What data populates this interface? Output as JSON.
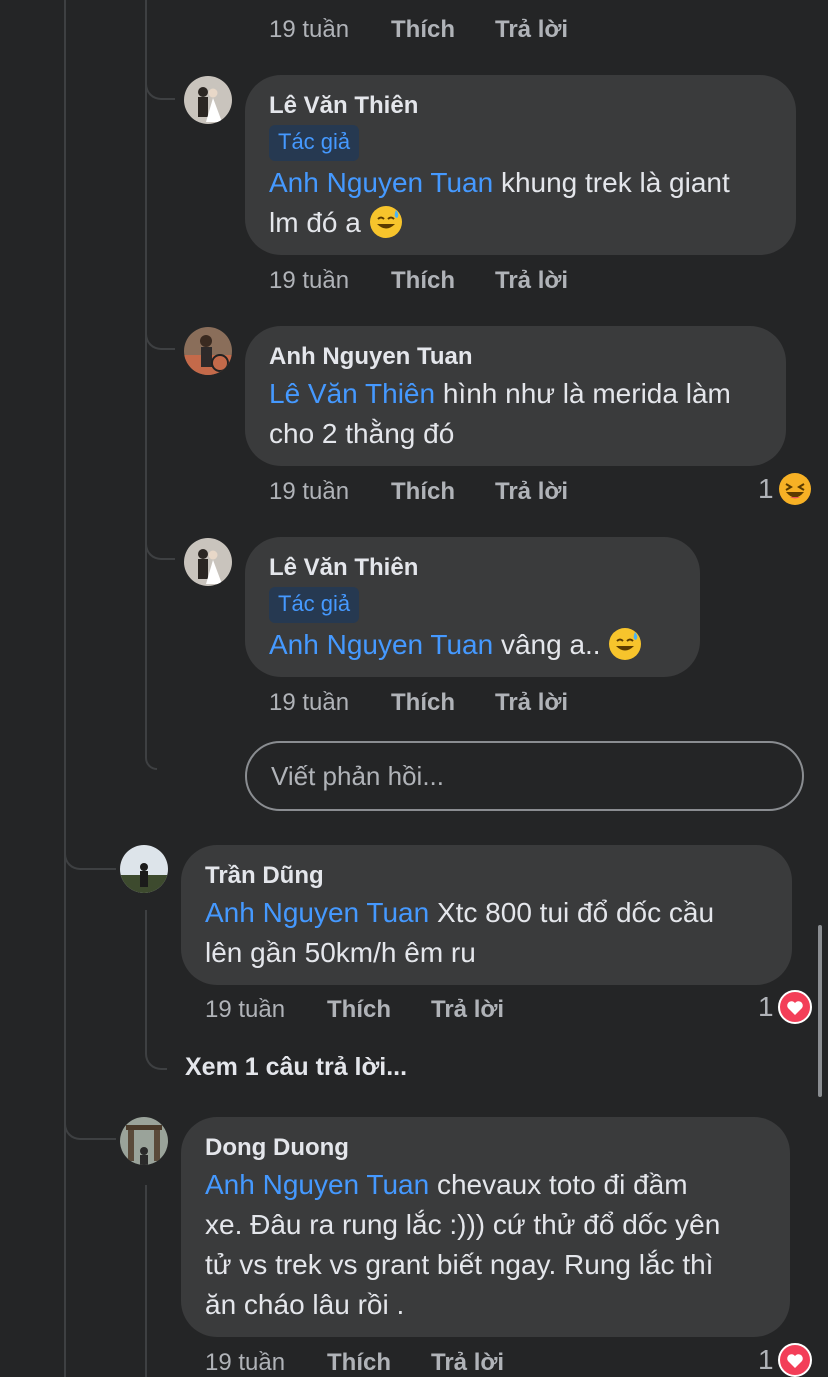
{
  "labels": {
    "like": "Thích",
    "reply": "Trả lời",
    "author_badge": "Tác giả"
  },
  "top_meta": {
    "time": "19 tuần"
  },
  "replies": [
    {
      "author": "Lê Văn Thiên",
      "is_author": true,
      "mention": "Anh Nguyen Tuan",
      "text_lines": [
        " khung trek là giant",
        "lm đó a "
      ],
      "emoji": "sweat-smile-emoji",
      "time": "19 tuần"
    },
    {
      "author": "Anh Nguyen Tuan",
      "is_author": false,
      "mention": "Lê Văn Thiên",
      "text_lines": [
        " hình như là merida làm",
        "cho 2 thằng đó"
      ],
      "time": "19 tuần",
      "reaction_count": "1",
      "reaction": "laugh-emoji"
    },
    {
      "author": "Lê Văn Thiên",
      "is_author": true,
      "mention": "Anh Nguyen Tuan",
      "text_lines": [
        " vâng a.. "
      ],
      "emoji": "sweat-smile-emoji",
      "time": "19 tuần"
    }
  ],
  "reply_input": {
    "placeholder": "Viết phản hồi..."
  },
  "comments": [
    {
      "author": "Trần Dũng",
      "mention": "Anh Nguyen Tuan",
      "text_lines": [
        " Xtc 800 tui đổ dốc cầu",
        "lên gần 50km/h êm ru"
      ],
      "time": "19 tuần",
      "reaction_count": "1",
      "reaction": "love-icon",
      "view_replies": "Xem 1 câu trả lời..."
    },
    {
      "author": "Dong Duong",
      "mention": "Anh Nguyen Tuan",
      "text_lines": [
        " chevaux toto đi đầm",
        "xe. Đâu ra rung lắc :))) cứ thử đổ dốc yên",
        "tử vs trek vs grant biết ngay. Rung lắc thì",
        "ăn cháo lâu rồi ."
      ],
      "time": "19 tuần",
      "reaction_count": "1",
      "reaction": "love-icon"
    }
  ],
  "colors": {
    "background": "#242526",
    "bubble": "#3a3b3c",
    "link": "#4599ff",
    "secondary_text": "#b0b3b8",
    "love": "#f33e58",
    "haha": "#f7b125"
  }
}
